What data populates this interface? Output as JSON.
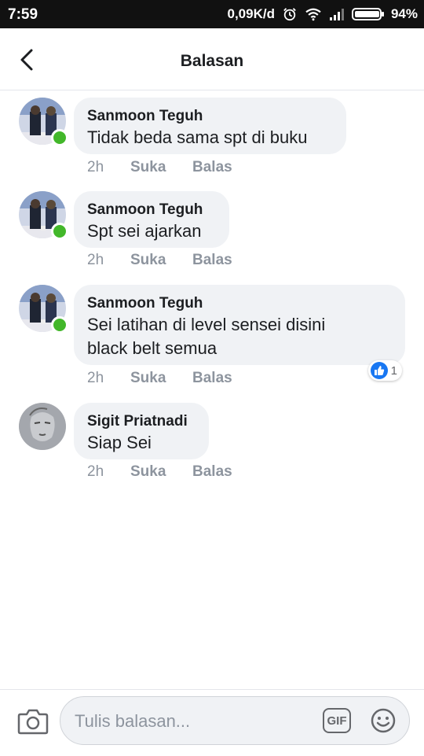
{
  "status_bar": {
    "time": "7:59",
    "network_speed": "0,09K/d",
    "battery": "94%",
    "icons": [
      "alarm-icon",
      "wifi-icon",
      "signal-icon",
      "battery-icon"
    ]
  },
  "header": {
    "title": "Balasan",
    "back_icon": "back-arrow-icon"
  },
  "comments": [
    {
      "author": "Sanmoon Teguh",
      "text": "Tidak beda sama spt di buku",
      "time": "2h",
      "like_label": "Suka",
      "reply_label": "Balas",
      "online": true
    },
    {
      "author": "Sanmoon Teguh",
      "text": "Spt sei ajarkan",
      "time": "2h",
      "like_label": "Suka",
      "reply_label": "Balas",
      "online": true
    },
    {
      "author": "Sanmoon Teguh",
      "text_line1": "Sei latihan di level sensei disini",
      "text_line2": "black belt semua",
      "time": "2h",
      "like_label": "Suka",
      "reply_label": "Balas",
      "online": true,
      "reaction_count": "1"
    },
    {
      "author": "Sigit Priatnadi",
      "text": "Siap Sei",
      "time": "2h",
      "like_label": "Suka",
      "reply_label": "Balas",
      "online": false
    }
  ],
  "composer": {
    "placeholder": "Tulis balasan...",
    "gif_label": "GIF",
    "icons": [
      "camera-icon",
      "gif-icon",
      "emoji-icon"
    ]
  },
  "colors": {
    "online": "#42b72a",
    "like_blue": "#1877f2",
    "bubble_bg": "#f0f2f5",
    "meta_gray": "#8d949e"
  }
}
